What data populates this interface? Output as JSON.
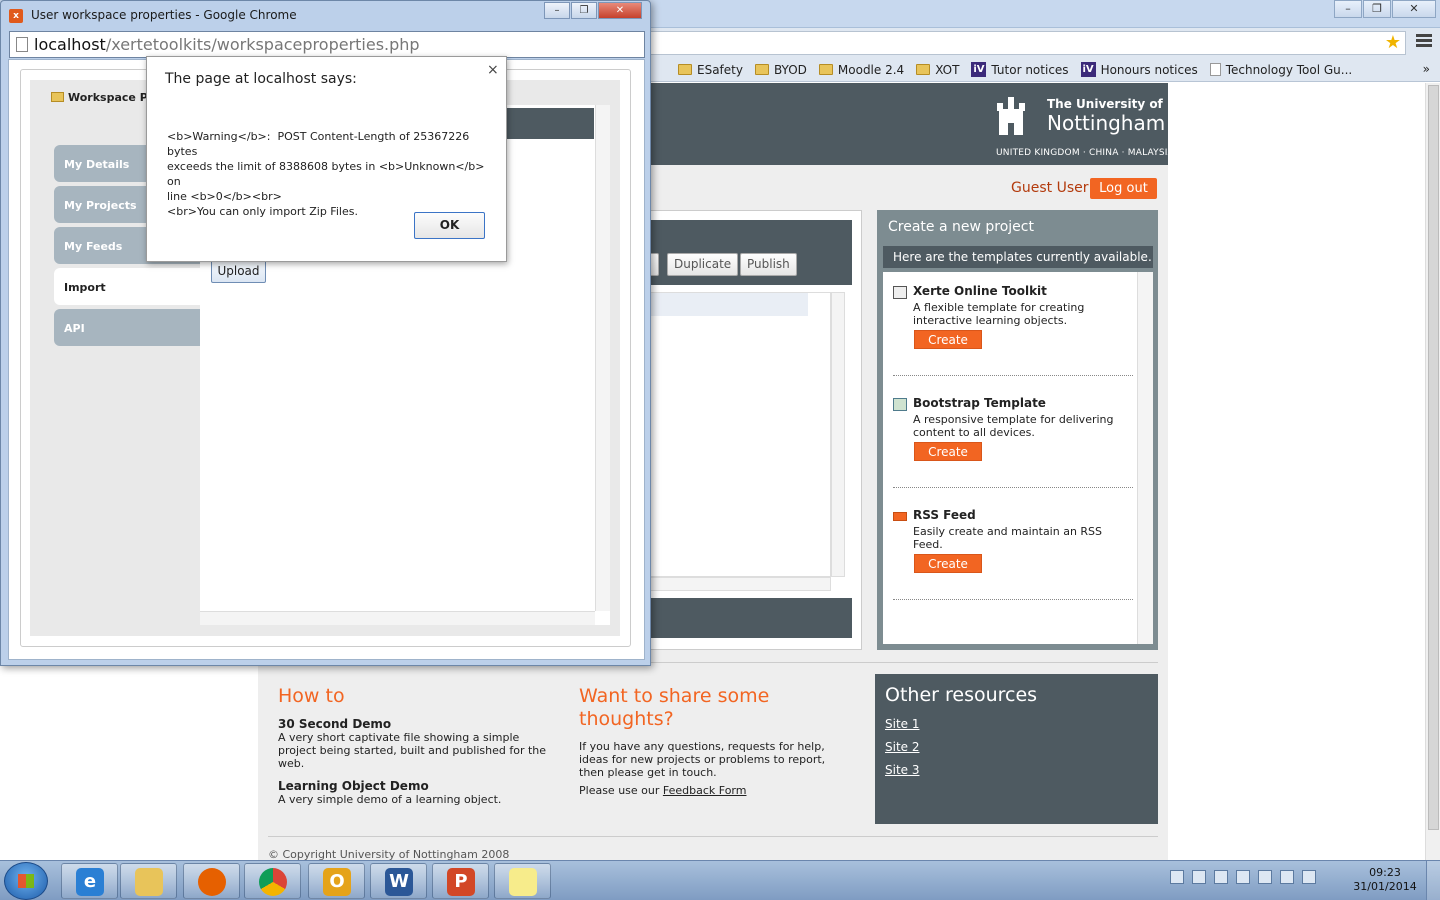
{
  "popup": {
    "title": "User workspace properties - Google Chrome",
    "url_host": "localhost",
    "url_path": "/xertetoolkits/workspaceproperties.php",
    "panel_title": "Workspace Pr",
    "tabs": [
      "My Details",
      "My Projects",
      "My Feeds",
      "Import",
      "API"
    ],
    "active_tab": "Import",
    "upload_label": "Upload"
  },
  "alert": {
    "title": "The page at localhost says:",
    "close": "×",
    "lines": [
      "<b>Warning</b>:  POST Content-Length of 25367226 bytes",
      "exceeds the limit of 8388608 bytes in <b>Unknown</b> on",
      "line <b>0</b><br>",
      "<br>You can only import Zip Files."
    ],
    "ok_label": "OK"
  },
  "browser": {
    "bookmarks": [
      {
        "label": "ESafety",
        "icon": "folder-icon"
      },
      {
        "label": "BYOD",
        "icon": "folder-icon"
      },
      {
        "label": "Moodle 2.4",
        "icon": "folder-icon"
      },
      {
        "label": "XOT",
        "icon": "folder-icon"
      },
      {
        "label": "Tutor notices",
        "icon": "iv-icon"
      },
      {
        "label": "Honours notices",
        "icon": "iv-icon"
      },
      {
        "label": "Technology Tool Gu...",
        "icon": "page-icon"
      }
    ],
    "bookmarks_more": "»"
  },
  "header": {
    "uni_small": "The University of",
    "uni_big": "Nottingham",
    "uni_sub": "UNITED KINGDOM · CHINA · MALAYSIA",
    "guest": "Guest User",
    "logout": "Log out"
  },
  "workspace": {
    "buttons": [
      "Duplicate",
      "Publish"
    ]
  },
  "templates": {
    "title": "Create a new project",
    "subtitle": "Here are the templates currently available.",
    "items": [
      {
        "name": "Xerte Online Toolkit",
        "desc": "A flexible template for creating interactive learning objects.",
        "button": "Create"
      },
      {
        "name": "Bootstrap Template",
        "desc": "A responsive template for delivering content to all devices.",
        "button": "Create"
      },
      {
        "name": "RSS Feed",
        "desc": "Easily create and maintain an RSS Feed.",
        "button": "Create"
      }
    ]
  },
  "howto": {
    "title": "How to",
    "items": [
      {
        "title": "30 Second Demo",
        "desc": "A very short captivate file showing a simple project being started, built and published for the web."
      },
      {
        "title": "Learning Object Demo",
        "desc": "A very simple demo of a learning object."
      }
    ]
  },
  "share": {
    "title": "Want to share some thoughts?",
    "desc": "If you have any questions, requests for help, ideas for new projects or problems to report, then please get in touch.",
    "feedback_prefix": "Please use our ",
    "feedback_link": "Feedback Form"
  },
  "resources": {
    "title": "Other resources",
    "links": [
      "Site 1",
      "Site 2",
      "Site 3"
    ]
  },
  "footer": {
    "copyright": "© Copyright University of Nottingham 2008"
  },
  "taskbar": {
    "apps": [
      "internet-explorer",
      "windows-explorer",
      "firefox",
      "chrome",
      "outlook",
      "word",
      "powerpoint",
      "sticky-notes"
    ],
    "time": "09:23",
    "date": "31/01/2014"
  }
}
